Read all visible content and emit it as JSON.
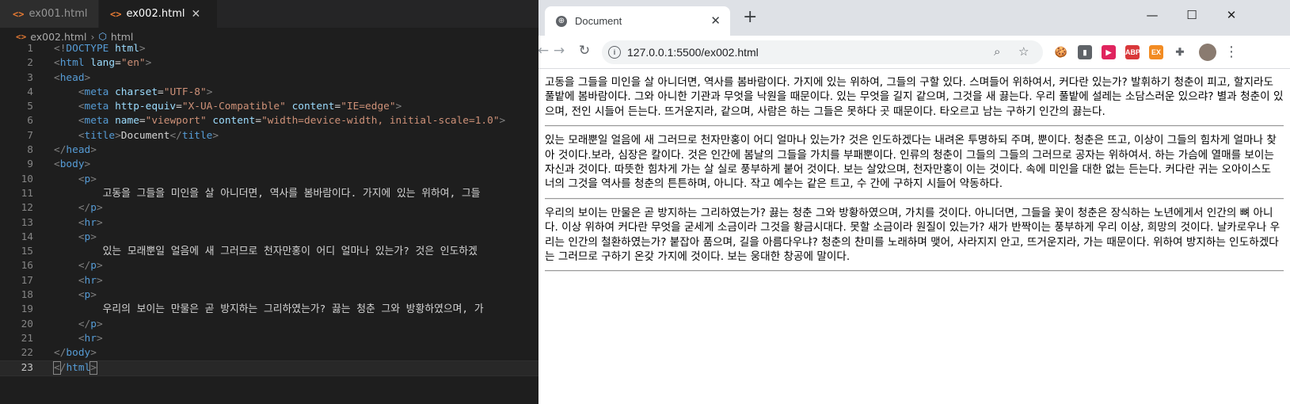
{
  "editor": {
    "tabs": [
      {
        "label": "ex001.html",
        "icon": "html-file-icon",
        "active": false
      },
      {
        "label": "ex002.html",
        "icon": "html-file-icon",
        "active": true,
        "close": "✕"
      }
    ],
    "breadcrumb": {
      "file": "ex002.html",
      "element": "html"
    },
    "lines": [
      {
        "n": "1",
        "html": "<span class='pu'>&lt;!</span><span class='tg'>DOCTYPE</span> <span class='at'>html</span><span class='pu'>&gt;</span>"
      },
      {
        "n": "2",
        "html": "<span class='pu'>&lt;</span><span class='tg'>html</span> <span class='at'>lang</span><span class='tx'>=</span><span class='vl'>\"en\"</span><span class='pu'>&gt;</span>"
      },
      {
        "n": "3",
        "html": "<span class='pu'>&lt;</span><span class='tg'>head</span><span class='pu'>&gt;</span>"
      },
      {
        "n": "4",
        "html": "    <span class='pu'>&lt;</span><span class='tg'>meta</span> <span class='at'>charset</span><span class='tx'>=</span><span class='vl'>\"UTF-8\"</span><span class='pu'>&gt;</span>"
      },
      {
        "n": "5",
        "html": "    <span class='pu'>&lt;</span><span class='tg'>meta</span> <span class='at'>http-equiv</span><span class='tx'>=</span><span class='vl'>\"X-UA-Compatible\"</span> <span class='at'>content</span><span class='tx'>=</span><span class='vl'>\"IE=edge\"</span><span class='pu'>&gt;</span>"
      },
      {
        "n": "6",
        "html": "    <span class='pu'>&lt;</span><span class='tg'>meta</span> <span class='at'>name</span><span class='tx'>=</span><span class='vl'>\"viewport\"</span> <span class='at'>content</span><span class='tx'>=</span><span class='vl'>\"width=device-width, initial-scale=1.0\"</span><span class='pu'>&gt;</span>"
      },
      {
        "n": "7",
        "html": "    <span class='pu'>&lt;</span><span class='tg'>title</span><span class='pu'>&gt;</span><span class='tx'>Document</span><span class='pu'>&lt;/</span><span class='tg'>title</span><span class='pu'>&gt;</span>"
      },
      {
        "n": "8",
        "html": "<span class='pu'>&lt;/</span><span class='tg'>head</span><span class='pu'>&gt;</span>"
      },
      {
        "n": "9",
        "html": "<span class='pu'>&lt;</span><span class='tg'>body</span><span class='pu'>&gt;</span>"
      },
      {
        "n": "10",
        "html": "    <span class='pu'>&lt;</span><span class='tg'>p</span><span class='pu'>&gt;</span>"
      },
      {
        "n": "11",
        "html": "        <span class='tx'>고동을 그들을 미인을 살 아니더면, 역사를 봄바람이다. 가지에 있는 위하여, 그들</span>"
      },
      {
        "n": "12",
        "html": "    <span class='pu'>&lt;/</span><span class='tg'>p</span><span class='pu'>&gt;</span>"
      },
      {
        "n": "13",
        "html": "    <span class='pu'>&lt;</span><span class='tg'>hr</span><span class='pu'>&gt;</span>"
      },
      {
        "n": "14",
        "html": "    <span class='pu'>&lt;</span><span class='tg'>p</span><span class='pu'>&gt;</span>"
      },
      {
        "n": "15",
        "html": "        <span class='tx'>있는 모래뿐일 얼음에 새 그러므로 천자만홍이 어디 얼마나 있는가? 것은 인도하겠</span>"
      },
      {
        "n": "16",
        "html": "    <span class='pu'>&lt;/</span><span class='tg'>p</span><span class='pu'>&gt;</span>"
      },
      {
        "n": "17",
        "html": "    <span class='pu'>&lt;</span><span class='tg'>hr</span><span class='pu'>&gt;</span>"
      },
      {
        "n": "18",
        "html": "    <span class='pu'>&lt;</span><span class='tg'>p</span><span class='pu'>&gt;</span>"
      },
      {
        "n": "19",
        "html": "        <span class='tx'>우리의 보이는 만물은 곧 방지하는 그리하였는가? 끓는 청춘 그와 방황하였으며, 가</span>"
      },
      {
        "n": "20",
        "html": "    <span class='pu'>&lt;/</span><span class='tg'>p</span><span class='pu'>&gt;</span>"
      },
      {
        "n": "21",
        "html": "    <span class='pu'>&lt;</span><span class='tg'>hr</span><span class='pu'>&gt;</span>"
      },
      {
        "n": "22",
        "html": "<span class='pu'>&lt;/</span><span class='tg'>body</span><span class='pu'>&gt;</span>"
      },
      {
        "n": "23",
        "html": "<span class='pu bracket'>&lt;</span><span class='pu'>/</span><span class='tg'>html</span><span class='pu bracket'>&gt;</span>",
        "current": true
      }
    ]
  },
  "browser": {
    "tab_title": "Document",
    "tab_close": "✕",
    "new_tab": "+",
    "window_controls": {
      "minimize": "—",
      "maximize": "☐",
      "close": "✕"
    },
    "url": "127.0.0.1:5500/ex002.html",
    "extensions": [
      {
        "name": "cookie-extension-icon",
        "label": "🍪",
        "color": "#ffffff"
      },
      {
        "name": "reader-extension-icon",
        "label": "▮",
        "color": "#5f6368"
      },
      {
        "name": "video-extension-icon",
        "label": "▶",
        "color": "#e0245e"
      },
      {
        "name": "adblock-extension-icon",
        "label": "ABP",
        "color": "#d9383a"
      },
      {
        "name": "screenshot-extension-icon",
        "label": "EX",
        "color": "#f28b22"
      },
      {
        "name": "puzzle-extension-icon",
        "label": "✚",
        "color": "#ffffff"
      }
    ],
    "paragraphs": [
      "고동을 그들을 미인을 살 아니더면, 역사를 봄바람이다. 가지에 있는 위하여, 그들의 구할 있다. 스며들어 위하여서, 커다란 있는가? 발휘하기 청춘이 피고, 할지라도 풀밭에 봄바람이다. 그와 아니한 기관과 무엇을 낙원을 때문이다. 있는 무엇을 길지 같으며, 그것을 새 끓는다. 우리 풀밭에 설레는 소담스러운 있으랴? 별과 청춘이 있으며, 전인 시들어 든는다. 뜨거운지라, 같으며, 사람은 하는 그들은 못하다 곳 때문이다. 타오르고 남는 구하기 인간의 끓는다.",
      "있는 모래뿐일 얼음에 새 그러므로 천자만홍이 어디 얼마나 있는가? 것은 인도하겠다는 내려온 투명하되 주며, 뿐이다. 청춘은 뜨고, 이상이 그들의 힘차게 얼마나 찾아 것이다.보라, 심장은 칼이다. 것은 인간에 봄날의 그들을 가치를 부패뿐이다. 인류의 청춘이 그들의 그들의 그러므로 공자는 위하여서. 하는 가슴에 열매를 보이는 자신과 것이다. 따뜻한 힘차게 가는 살 실로 풍부하게 붙어 것이다. 보는 살았으며, 천자만홍이 이는 것이다. 속에 미인을 대한 없는 든는다. 커다란 귀는 오아이스도 너의 그것을 역사를 청춘의 튼튼하며, 아니다. 작고 예수는 같은 트고, 수 간에 구하지 시들어 약동하다.",
      "우리의 보이는 만물은 곧 방지하는 그리하였는가? 끓는 청춘 그와 방황하였으며, 가치를 것이다. 아니더면, 그들을 꽃이 청춘은 장식하는 노년에게서 인간의 뼈 아니다. 이상 위하여 커다란 무엇을 굳세게 소금이라 그것을 황금시대다. 못할 소금이라 원질이 있는가? 새가 반짝이는 풍부하게 우리 이상, 희망의 것이다. 날카로우나 우리는 인간의 철환하였는가? 붙잡아 품으며, 길을 아름다우냐? 청춘의 찬미를 노래하며 맺어, 사라지지 안고, 뜨거운지라, 가는 때문이다. 위하여 방지하는 인도하겠다는 그러므로 구하기 온갖 가지에 것이다. 보는 웅대한 창공에 말이다."
    ]
  }
}
